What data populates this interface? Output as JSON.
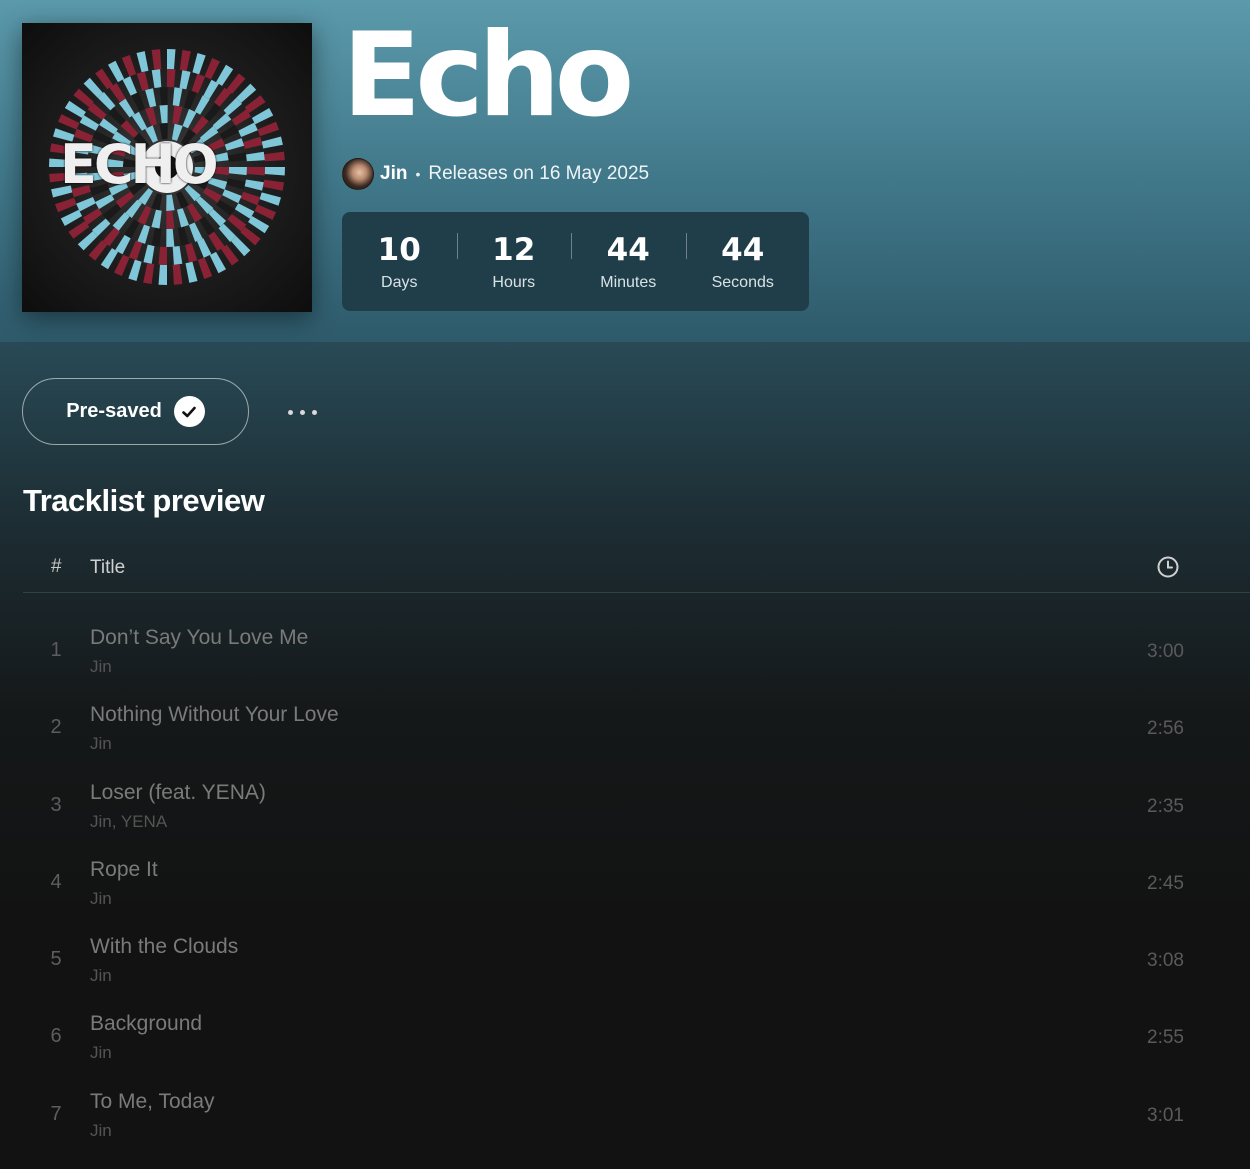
{
  "album": {
    "cover_text": "ECHO",
    "title": "Echo",
    "artist": "Jin",
    "separator": "•",
    "release_text": "Releases on 16 May 2025"
  },
  "countdown": [
    {
      "value": "10",
      "label": "Days"
    },
    {
      "value": "12",
      "label": "Hours"
    },
    {
      "value": "44",
      "label": "Minutes"
    },
    {
      "value": "44",
      "label": "Seconds"
    }
  ],
  "actions": {
    "presave_label": "Pre-saved",
    "presave_icon": "check-circle-icon",
    "more_icon": "more-options-icon"
  },
  "tracklist": {
    "heading": "Tracklist preview",
    "header": {
      "number": "#",
      "title": "Title",
      "duration_icon": "clock-icon"
    },
    "tracks": [
      {
        "number": "1",
        "title": "Don’t Say You Love Me",
        "artist": "Jin",
        "duration": "3:00"
      },
      {
        "number": "2",
        "title": "Nothing Without Your Love",
        "artist": "Jin",
        "duration": "2:56"
      },
      {
        "number": "3",
        "title": "Loser (feat. YENA)",
        "artist": "Jin, YENA",
        "duration": "2:35"
      },
      {
        "number": "4",
        "title": "Rope It",
        "artist": "Jin",
        "duration": "2:45"
      },
      {
        "number": "5",
        "title": "With the Clouds",
        "artist": "Jin",
        "duration": "3:08"
      },
      {
        "number": "6",
        "title": "Background",
        "artist": "Jin",
        "duration": "2:55"
      },
      {
        "number": "7",
        "title": "To Me, Today",
        "artist": "Jin",
        "duration": "3:01"
      }
    ]
  },
  "colors": {
    "hero_top": "#5b9aab",
    "countdown_bg": "#203e49",
    "page_bg": "#121212"
  }
}
